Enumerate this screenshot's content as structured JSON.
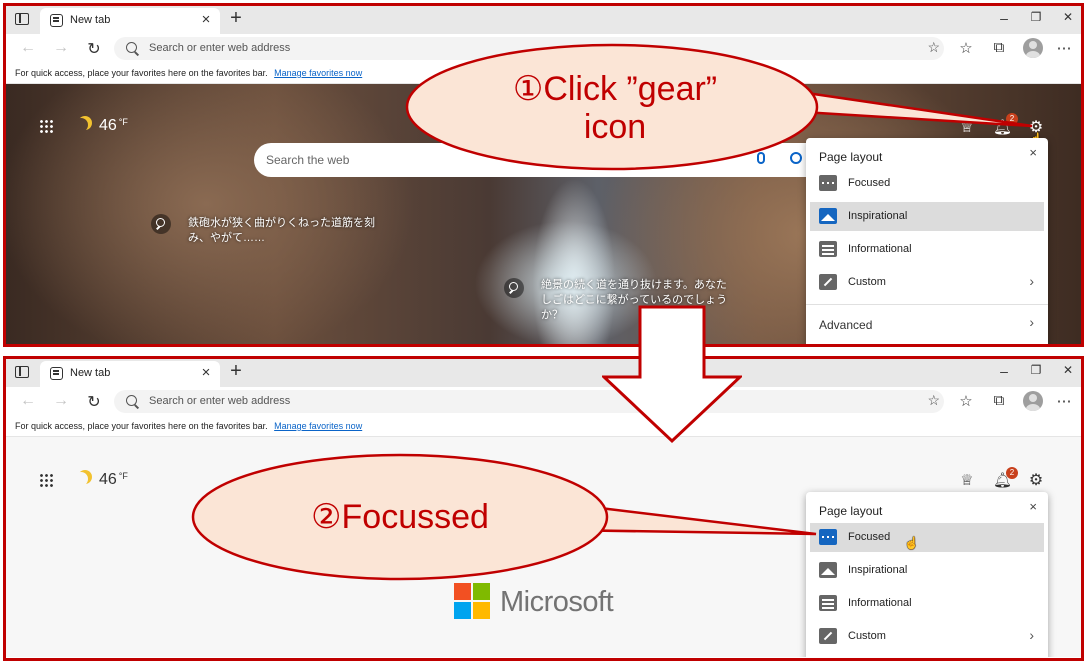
{
  "colors": {
    "frame_red": "#c00000",
    "callout_fill": "#fbe5d6",
    "link_blue": "#0a64c8",
    "focused_icon_blue": "#1566c0",
    "ms_red": "#f25022",
    "ms_green": "#7fba00",
    "ms_blue": "#00a4ef",
    "ms_yellow": "#ffb900"
  },
  "browser": {
    "tab_title": "New tab",
    "tab_close": "×",
    "new_tab": "+",
    "window_controls": {
      "minimize": "–",
      "restore": "❐",
      "close": "✕"
    },
    "nav": {
      "back": "←",
      "forward": "→",
      "refresh": "↻"
    },
    "address_placeholder": "Search or enter web address",
    "toolbar_icons": [
      "add-favorite-icon",
      "favorites-icon",
      "collections-icon",
      "profile-avatar"
    ],
    "favbar_text": "For quick access, place your favorites here on the favorites bar.",
    "favbar_link": "Manage favorites now"
  },
  "newtab": {
    "apps_icon": "app-launcher-icon",
    "weather_temp": "46",
    "weather_unit": "°F",
    "weather_icon": "moon-icon",
    "search_placeholder": "Search the web",
    "caption_1": "鉄砲水が狭く曲がりくねった道筋を刻み、やがて……",
    "caption_2": "絶景の続く道を通り抜けます。あなたしごはどこに繋がっているのでしょうか？",
    "notification_count": "2",
    "rewards_icon": "rewards-trophy-icon",
    "settings_icon": "gear-icon"
  },
  "page_layout": {
    "title": "Page layout",
    "close": "×",
    "items": [
      {
        "label": "Focused",
        "icon": "focused-layout-icon"
      },
      {
        "label": "Inspirational",
        "icon": "inspirational-layout-icon"
      },
      {
        "label": "Informational",
        "icon": "informational-layout-icon"
      },
      {
        "label": "Custom",
        "icon": "custom-layout-icon",
        "chevron": "›"
      }
    ],
    "advanced": "Advanced",
    "advanced_chevron": "›",
    "selected_top": "Inspirational",
    "selected_bottom": "Focused"
  },
  "brand": {
    "name": "Microsoft"
  },
  "callouts": {
    "step1_line1": "①Click ”gear”",
    "step1_line2": "icon",
    "step2": "②Focussed"
  }
}
